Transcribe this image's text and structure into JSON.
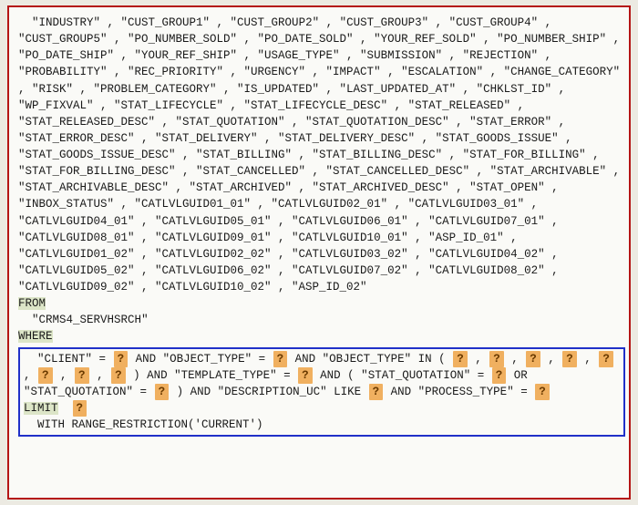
{
  "select_columns": [
    "INDUSTRY",
    "CUST_GROUP1",
    "CUST_GROUP2",
    "CUST_GROUP3",
    "CUST_GROUP4",
    "CUST_GROUP5",
    "PO_NUMBER_SOLD",
    "PO_DATE_SOLD",
    "YOUR_REF_SOLD",
    "PO_NUMBER_SHIP",
    "PO_DATE_SHIP",
    "YOUR_REF_SHIP",
    "USAGE_TYPE",
    "SUBMISSION",
    "REJECTION",
    "PROBABILITY",
    "REC_PRIORITY",
    "URGENCY",
    "IMPACT",
    "ESCALATION",
    "CHANGE_CATEGORY",
    "RISK",
    "PROBLEM_CATEGORY",
    "IS_UPDATED",
    "LAST_UPDATED_AT",
    "CHKLST_ID",
    "WP_FIXVAL",
    "STAT_LIFECYCLE",
    "STAT_LIFECYCLE_DESC",
    "STAT_RELEASED",
    "STAT_RELEASED_DESC",
    "STAT_QUOTATION",
    "STAT_QUOTATION_DESC",
    "STAT_ERROR",
    "STAT_ERROR_DESC",
    "STAT_DELIVERY",
    "STAT_DELIVERY_DESC",
    "STAT_GOODS_ISSUE",
    "STAT_GOODS_ISSUE_DESC",
    "STAT_BILLING",
    "STAT_BILLING_DESC",
    "STAT_FOR_BILLING",
    "STAT_FOR_BILLING_DESC",
    "STAT_CANCELLED",
    "STAT_CANCELLED_DESC",
    "STAT_ARCHIVABLE",
    "STAT_ARCHIVABLE_DESC",
    "STAT_ARCHIVED",
    "STAT_ARCHIVED_DESC",
    "STAT_OPEN",
    "INBOX_STATUS",
    "CATLVLGUID01_01",
    "CATLVLGUID02_01",
    "CATLVLGUID03_01",
    "CATLVLGUID04_01",
    "CATLVLGUID05_01",
    "CATLVLGUID06_01",
    "CATLVLGUID07_01",
    "CATLVLGUID08_01",
    "CATLVLGUID09_01",
    "CATLVLGUID10_01",
    "ASP_ID_01",
    "CATLVLGUID01_02",
    "CATLVLGUID02_02",
    "CATLVLGUID03_02",
    "CATLVLGUID04_02",
    "CATLVLGUID05_02",
    "CATLVLGUID06_02",
    "CATLVLGUID07_02",
    "CATLVLGUID08_02",
    "CATLVLGUID09_02",
    "CATLVLGUID10_02",
    "ASP_ID_02"
  ],
  "keywords": {
    "from": "FROM",
    "where": "WHERE",
    "limit": "LIMIT"
  },
  "from_table": "CRMS4_SERVHSRCH",
  "where": {
    "c1": "CLIENT",
    "c2": "OBJECT_TYPE",
    "c3": "OBJECT_TYPE",
    "c4": "TEMPLATE_TYPE",
    "c5": "STAT_QUOTATION",
    "c6": "STAT_QUOTATION",
    "c7": "DESCRIPTION_UC",
    "c8": "PROCESS_TYPE",
    "ph": "?"
  },
  "tail": "WITH RANGE_RESTRICTION('CURRENT')"
}
